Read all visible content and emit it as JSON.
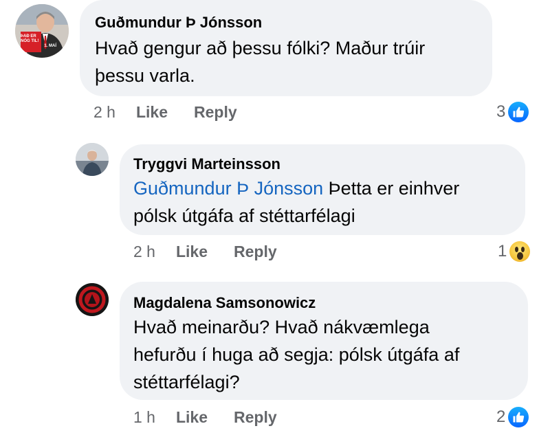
{
  "comments": [
    {
      "author": "Guðmundur Þ Jónsson",
      "text_line1": "Hvað gengur að þessu fólki? Maður trúir",
      "text_line2": "þessu varla.",
      "time": "2 h",
      "like_label": "Like",
      "reply_label": "Reply",
      "reaction_count": "3",
      "reaction_icon": "like-icon",
      "avatar_badge_line1": "ÞAÐ ER",
      "avatar_badge_line2": "NÓG TIL!",
      "avatar_badge_line3": "1. MAÍ"
    },
    {
      "author": "Tryggvi Marteinsson",
      "mention": "Guðmundur Þ Jónsson",
      "text_line1_rest": " Þetta er einhver",
      "text_line2": "pólsk útgáfa af stéttarfélagi",
      "time": "2 h",
      "like_label": "Like",
      "reply_label": "Reply",
      "reaction_count": "1",
      "reaction_icon": "wow-icon"
    },
    {
      "author": "Magdalena Samsonowicz",
      "text_line1": "Hvað meinarðu? Hvað nákvæmlega",
      "text_line2": "hefurðu í huga að segja: pólsk útgáfa af",
      "text_line3": "stéttarfélagi?",
      "time": "1 h",
      "like_label": "Like",
      "reply_label": "Reply",
      "reaction_count": "2",
      "reaction_icon": "like-icon"
    }
  ],
  "colors": {
    "bubble": "#f0f2f5",
    "mention": "#1565c0",
    "meta_text": "#65676b",
    "like_blue": "#0866ff"
  }
}
